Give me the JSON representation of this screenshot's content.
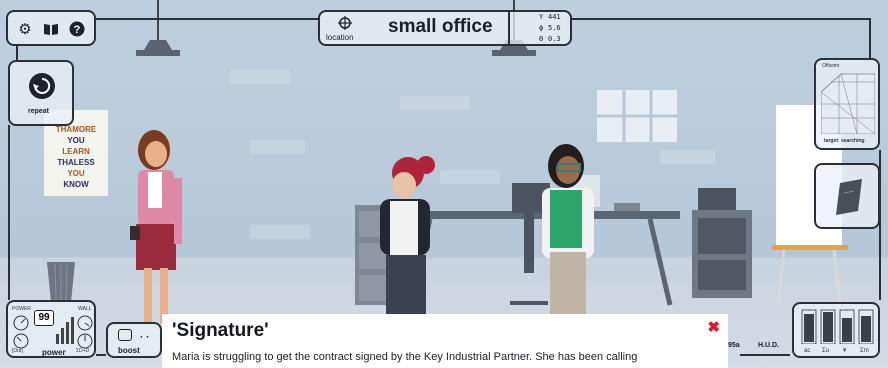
{
  "location": {
    "label": "location",
    "title": "small office"
  },
  "stats": {
    "line1": "441",
    "line2": "5.6",
    "line3": "0.3"
  },
  "top_left_icons": [
    "gear-icon",
    "book-icon",
    "help-icon"
  ],
  "repeat": {
    "label": "repeat"
  },
  "poster": {
    "lines": [
      "THAMORE",
      "YOU",
      "LEARN",
      "THALESS",
      "YOU",
      "KNOW"
    ]
  },
  "minimap": {
    "header": "Offsetm",
    "footer": "target: searching"
  },
  "power": {
    "value": "99",
    "label": "power",
    "top_left": "POWER",
    "top_right": "WALL",
    "bottom_left": "[Out]",
    "bottom_right": "ΣD+D"
  },
  "boost": {
    "label": "boost"
  },
  "hud": {
    "left": "95a",
    "label": "H.U.D."
  },
  "bars": {
    "labels": [
      "ac",
      "Σu",
      "¥",
      "Σm"
    ]
  },
  "dialog": {
    "title": "'Signature'",
    "text": "Maria is struggling to get the contract signed by the Key Industrial Partner. She has been calling",
    "close_icon": "close-icon",
    "close_color": "#d81e2a"
  }
}
